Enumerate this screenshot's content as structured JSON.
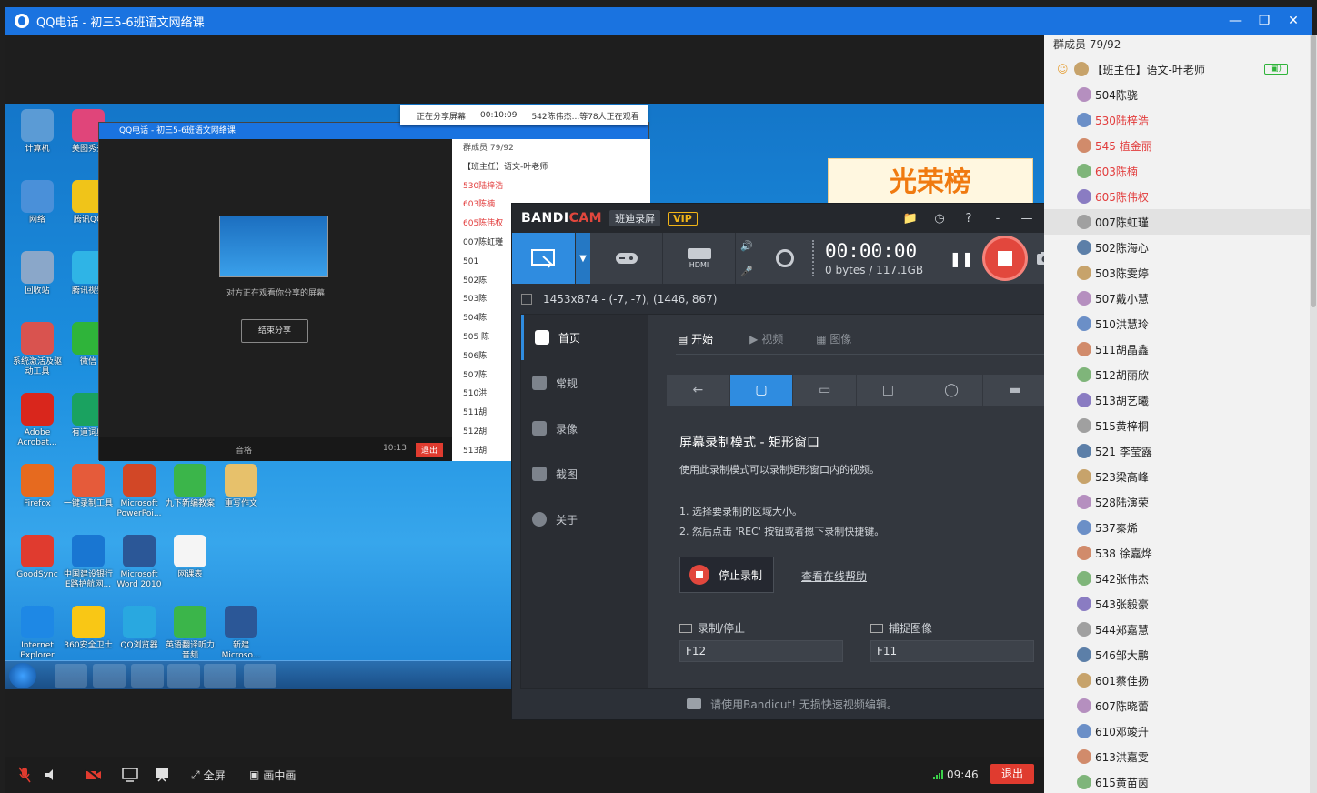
{
  "window": {
    "title": "QQ电话 - 初三5-6班语文网络课"
  },
  "shared_screen": {
    "share_banner": {
      "status": "正在分享屏幕",
      "time": "00:10:09",
      "viewers": "542陈伟杰...等78人正在观看"
    },
    "desktop_icons": [
      {
        "label": "计算机"
      },
      {
        "label": "美图秀秀"
      },
      {
        "label": "网络"
      },
      {
        "label": "腾讯QQ"
      },
      {
        "label": "回收站"
      },
      {
        "label": "腾讯视频"
      },
      {
        "label": "系统激活及驱动工具"
      },
      {
        "label": "微信"
      },
      {
        "label": "Adobe Acrobat..."
      },
      {
        "label": "有道词典"
      },
      {
        "label": "Firefox"
      },
      {
        "label": "一键录制工具"
      },
      {
        "label": "Microsoft PowerPoi..."
      },
      {
        "label": "九下新编教案"
      },
      {
        "label": "重写作文"
      },
      {
        "label": "GoodSync"
      },
      {
        "label": "中国建设银行 E路护航网..."
      },
      {
        "label": "Microsoft Word 2010"
      },
      {
        "label": "网课表"
      },
      {
        "label": "Internet Explorer"
      },
      {
        "label": "360安全卫士"
      },
      {
        "label": "QQ浏览器"
      },
      {
        "label": "英语翻译听力 音频"
      },
      {
        "label": "新建 Microso..."
      }
    ],
    "inner_qq": {
      "title": "QQ电话 - 初三5-6班语文网络课",
      "members_count": "群成员 79/92",
      "share_text": "对方正在观看你分享的屏幕",
      "end_share": "结束分享",
      "timer": "10:13",
      "exit": "退出",
      "mute": "音格",
      "list": [
        "【班主任】语文-叶老师",
        "530陆梓浩",
        "603陈楠",
        "605陈伟权",
        "007陈虹瑾",
        "501",
        "502陈",
        "503陈",
        "504陈",
        "505 陈",
        "506陈",
        "507陈",
        "510洪",
        "511胡",
        "512胡",
        "513胡"
      ]
    },
    "honor_text": "光荣榜"
  },
  "bandicam": {
    "logo_a": "BANDI",
    "logo_b": "CAM",
    "pill": "班迪录屏",
    "vip": "VIP",
    "timer": "00:00:00",
    "bytes": "0 bytes / 117.1GB",
    "size_text": "1453x874 - (-7, -7), (1446, 867)",
    "sidebar": [
      "首页",
      "常规",
      "录像",
      "截图",
      "关于"
    ],
    "tabs": [
      "开始",
      "视频",
      "图像"
    ],
    "mode_title": "屏幕录制模式 - 矩形窗口",
    "mode_desc": "使用此录制模式可以录制矩形窗口内的视频。",
    "step1": "1. 选择要录制的区域大小。",
    "step2": "2. 然后点击 'REC' 按钮或者摁下录制快捷键。",
    "stop_button": "停止录制",
    "help_link": "查看在线帮助",
    "hotkey_rec_label": "录制/停止",
    "hotkey_rec_value": "F12",
    "hotkey_cap_label": "捕捉图像",
    "hotkey_cap_value": "F11",
    "footer": "请使用Bandicut! 无损快速视频编辑。"
  },
  "members": {
    "header": "群成员 79/92",
    "list": [
      {
        "name": "【班主任】语文-叶老师",
        "color": "#222222"
      },
      {
        "name": "504陈骁",
        "color": "#222222"
      },
      {
        "name": "530陆梓浩",
        "color": "#e23c3c"
      },
      {
        "name": "545 植金丽",
        "color": "#e23c3c"
      },
      {
        "name": "603陈楠",
        "color": "#e23c3c"
      },
      {
        "name": "605陈伟权",
        "color": "#e23c3c"
      },
      {
        "name": "007陈虹瑾",
        "color": "#222222"
      },
      {
        "name": "502陈海心",
        "color": "#222222"
      },
      {
        "name": "503陈雯婷",
        "color": "#222222"
      },
      {
        "name": "507戴小慧",
        "color": "#222222"
      },
      {
        "name": "510洪慧玲",
        "color": "#222222"
      },
      {
        "name": "511胡晶鑫",
        "color": "#222222"
      },
      {
        "name": "512胡丽欣",
        "color": "#222222"
      },
      {
        "name": "513胡艺曦",
        "color": "#222222"
      },
      {
        "name": "515黄梓桐",
        "color": "#222222"
      },
      {
        "name": "521 李莹露",
        "color": "#222222"
      },
      {
        "name": "523梁高峰",
        "color": "#222222"
      },
      {
        "name": "528陆演荣",
        "color": "#222222"
      },
      {
        "name": "537秦烯",
        "color": "#222222"
      },
      {
        "name": "538 徐嘉烨",
        "color": "#222222"
      },
      {
        "name": "542张伟杰",
        "color": "#222222"
      },
      {
        "name": "543张毅豪",
        "color": "#222222"
      },
      {
        "name": "544郑嘉慧",
        "color": "#222222"
      },
      {
        "name": "546邹大鹏",
        "color": "#222222"
      },
      {
        "name": "601蔡佳扬",
        "color": "#222222"
      },
      {
        "name": "607陈晓蕾",
        "color": "#222222"
      },
      {
        "name": "610邓竣升",
        "color": "#222222"
      },
      {
        "name": "613洪嘉雯",
        "color": "#222222"
      },
      {
        "name": "615黄苗茵",
        "color": "#222222"
      }
    ]
  },
  "bottom_bar": {
    "fullscreen": "全屏",
    "pip": "画中画",
    "timer": "09:46",
    "exit": "退出"
  }
}
